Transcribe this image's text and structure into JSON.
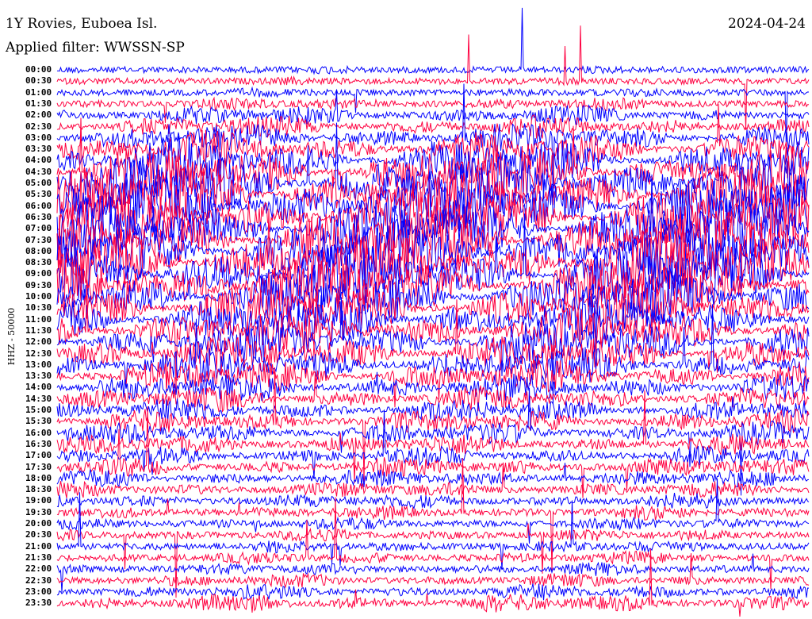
{
  "header": {
    "station": "1Y Rovies, Euboea Isl.",
    "filter": "Applied filter: WWSSN-SP",
    "date": "2024-04-24"
  },
  "chart_data": {
    "type": "line",
    "title": "1Y Rovies, Euboea Isl.",
    "ylabel": "HHZ - 50000",
    "xlabel": "",
    "colors": [
      "#0000ff",
      "#ff0040"
    ],
    "row_labels": [
      "00:00",
      "00:30",
      "01:00",
      "01:30",
      "02:00",
      "02:30",
      "03:00",
      "03:30",
      "04:00",
      "04:30",
      "05:00",
      "05:30",
      "06:00",
      "06:30",
      "07:00",
      "07:30",
      "08:00",
      "08:30",
      "09:00",
      "09:30",
      "10:00",
      "10:30",
      "11:00",
      "11:30",
      "12:00",
      "12:30",
      "13:00",
      "13:30",
      "14:00",
      "14:30",
      "15:00",
      "15:30",
      "16:00",
      "16:30",
      "17:00",
      "17:30",
      "18:00",
      "18:30",
      "19:00",
      "19:30",
      "20:00",
      "20:30",
      "21:00",
      "21:30",
      "22:00",
      "22:30",
      "23:00",
      "23:30"
    ],
    "relative_amplitude": [
      0.12,
      0.12,
      0.14,
      0.2,
      0.3,
      0.35,
      0.45,
      0.55,
      0.7,
      0.8,
      0.9,
      0.95,
      1.0,
      1.0,
      1.0,
      1.0,
      1.0,
      1.0,
      0.95,
      0.9,
      0.85,
      0.8,
      0.75,
      0.7,
      0.65,
      0.6,
      0.55,
      0.5,
      0.45,
      0.4,
      0.38,
      0.36,
      0.34,
      0.32,
      0.3,
      0.3,
      0.28,
      0.26,
      0.24,
      0.22,
      0.2,
      0.2,
      0.2,
      0.2,
      0.2,
      0.22,
      0.25,
      0.3
    ]
  }
}
